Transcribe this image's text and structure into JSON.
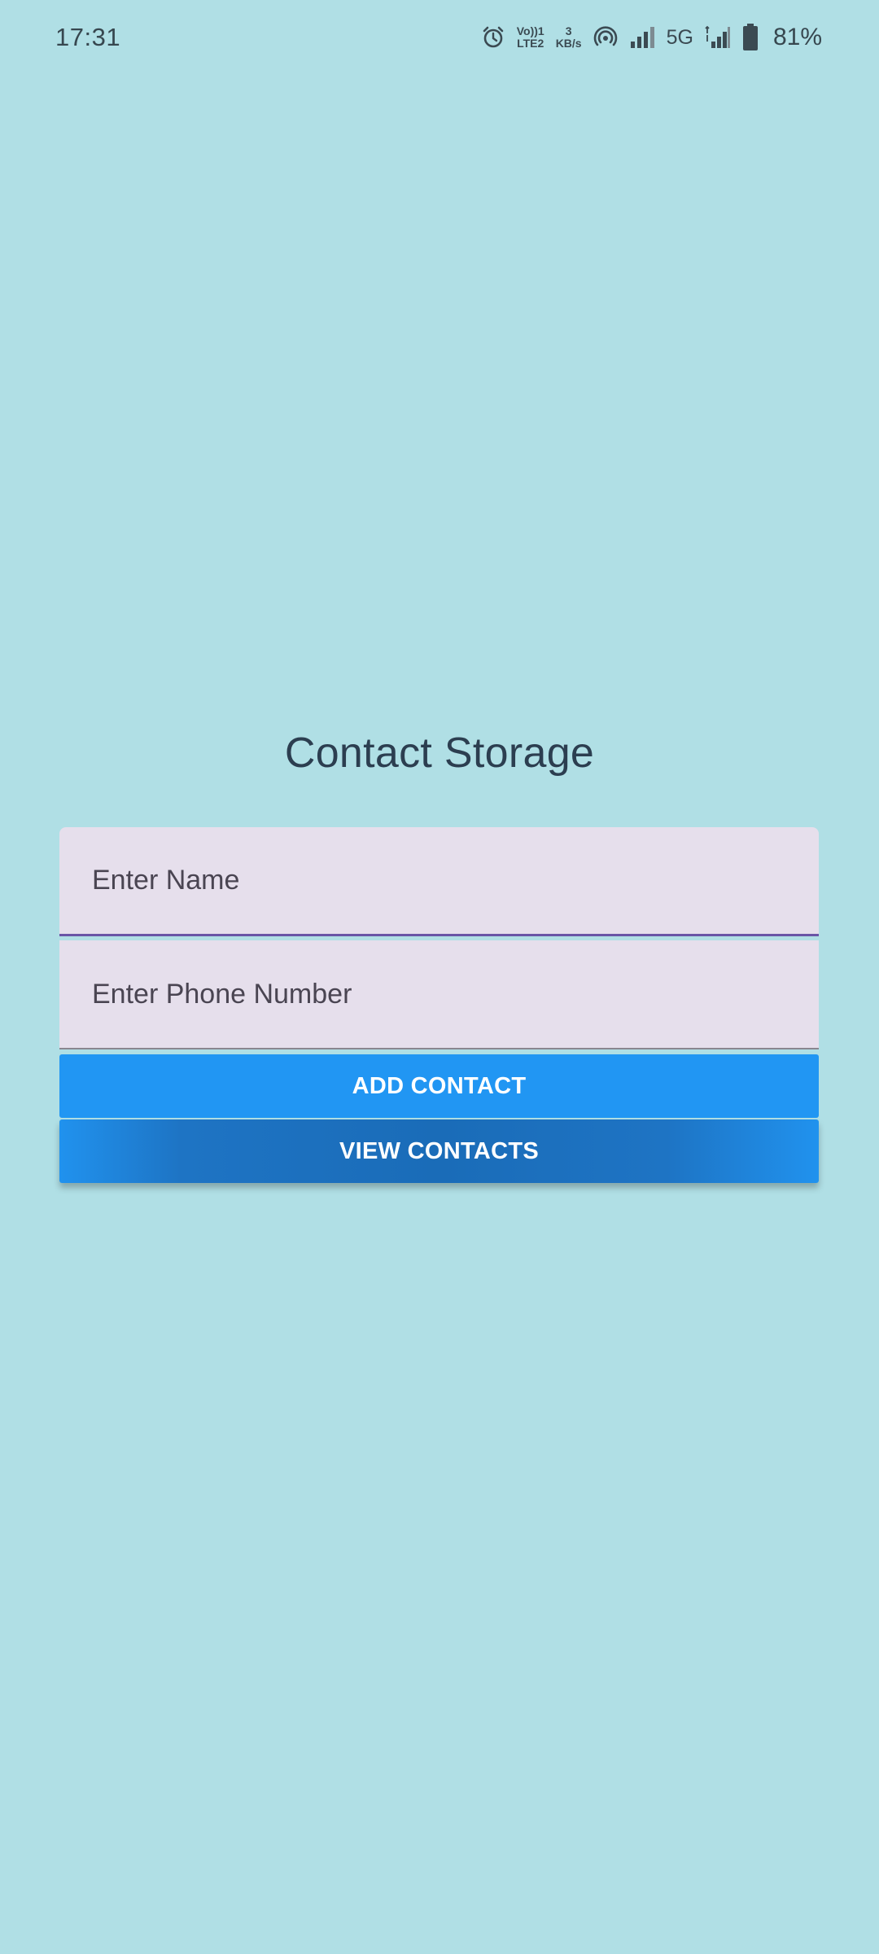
{
  "status_bar": {
    "time": "17:31",
    "icons": [
      "alarm-icon",
      "volte-icon",
      "hotspot-icon",
      "signal-icon",
      "5g-signal-icon",
      "battery-icon"
    ],
    "volte_line1": "Vo))1",
    "volte_line2": "LTE2",
    "speed_value": "3",
    "speed_unit": "KB/s",
    "network_type": "5G",
    "battery_percent": "81%"
  },
  "app": {
    "title": "Contact Storage",
    "name_field": {
      "placeholder": "Enter Name",
      "value": ""
    },
    "phone_field": {
      "placeholder": "Enter Phone Number",
      "value": ""
    },
    "add_button_label": "ADD CONTACT",
    "view_button_label": "VIEW CONTACTS"
  },
  "colors": {
    "background": "#b0dfe5",
    "field_background": "#e6dfec",
    "focus_underline": "#6a55a6",
    "add_button": "#2196f3",
    "view_button": "#1a6cb8"
  }
}
